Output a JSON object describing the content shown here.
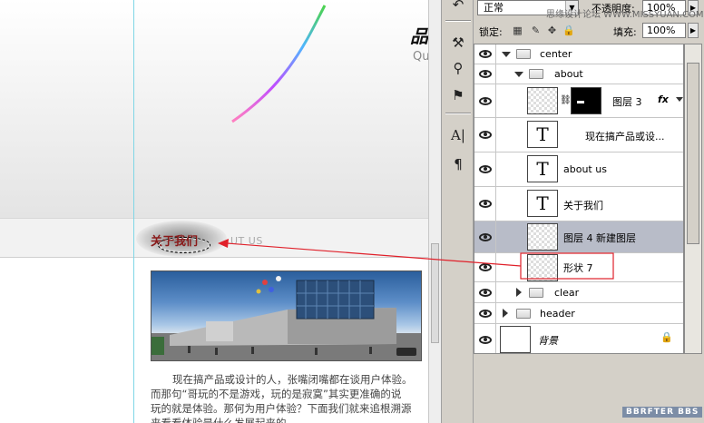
{
  "canvas": {
    "logo_char": "品",
    "logo_sub": "Qu",
    "about_title": "关于我们",
    "about_sub": "UT US",
    "paragraph_lines": [
      "现在搞产品或设计的人，张嘴闭嘴都在谈用户体验。",
      "而那句“哥玩的不是游戏，玩的是寂寞”其实更准确的说",
      "玩的就是体验。那何为用户体验？下面我们就来追根溯源",
      "来看看体验是什么发展起来的"
    ]
  },
  "panel": {
    "blend_mode": "正常",
    "opacity_label": "不透明度:",
    "opacity_value": "100%",
    "lock_label": "锁定:",
    "fill_label": "填充:",
    "fill_value": "100%"
  },
  "layers": [
    {
      "name": "center",
      "kind": "group",
      "expanded": true
    },
    {
      "name": "about",
      "kind": "group",
      "expanded": true
    },
    {
      "name": "图层 3",
      "kind": "layer",
      "fx": "fx"
    },
    {
      "name": "现在搞产品或设...",
      "kind": "text"
    },
    {
      "name": "about us",
      "kind": "text"
    },
    {
      "name": "关于我们",
      "kind": "text"
    },
    {
      "name": "图层 4 新建图层",
      "kind": "layer",
      "selected": true
    },
    {
      "name": "形状 7",
      "kind": "layer"
    },
    {
      "name": "clear",
      "kind": "group",
      "expanded": false
    },
    {
      "name": "header",
      "kind": "group",
      "expanded": false
    },
    {
      "name": "背景",
      "kind": "background"
    }
  ],
  "watermarks": {
    "top": "思缘设计论坛 WWW.MISSYUAN.COM",
    "bottom": "BBRFTER BBS"
  },
  "colors": {
    "annotation_red": "#e0202a",
    "selected_row": "#b8bcc8",
    "guide": "#7fd6e6"
  }
}
